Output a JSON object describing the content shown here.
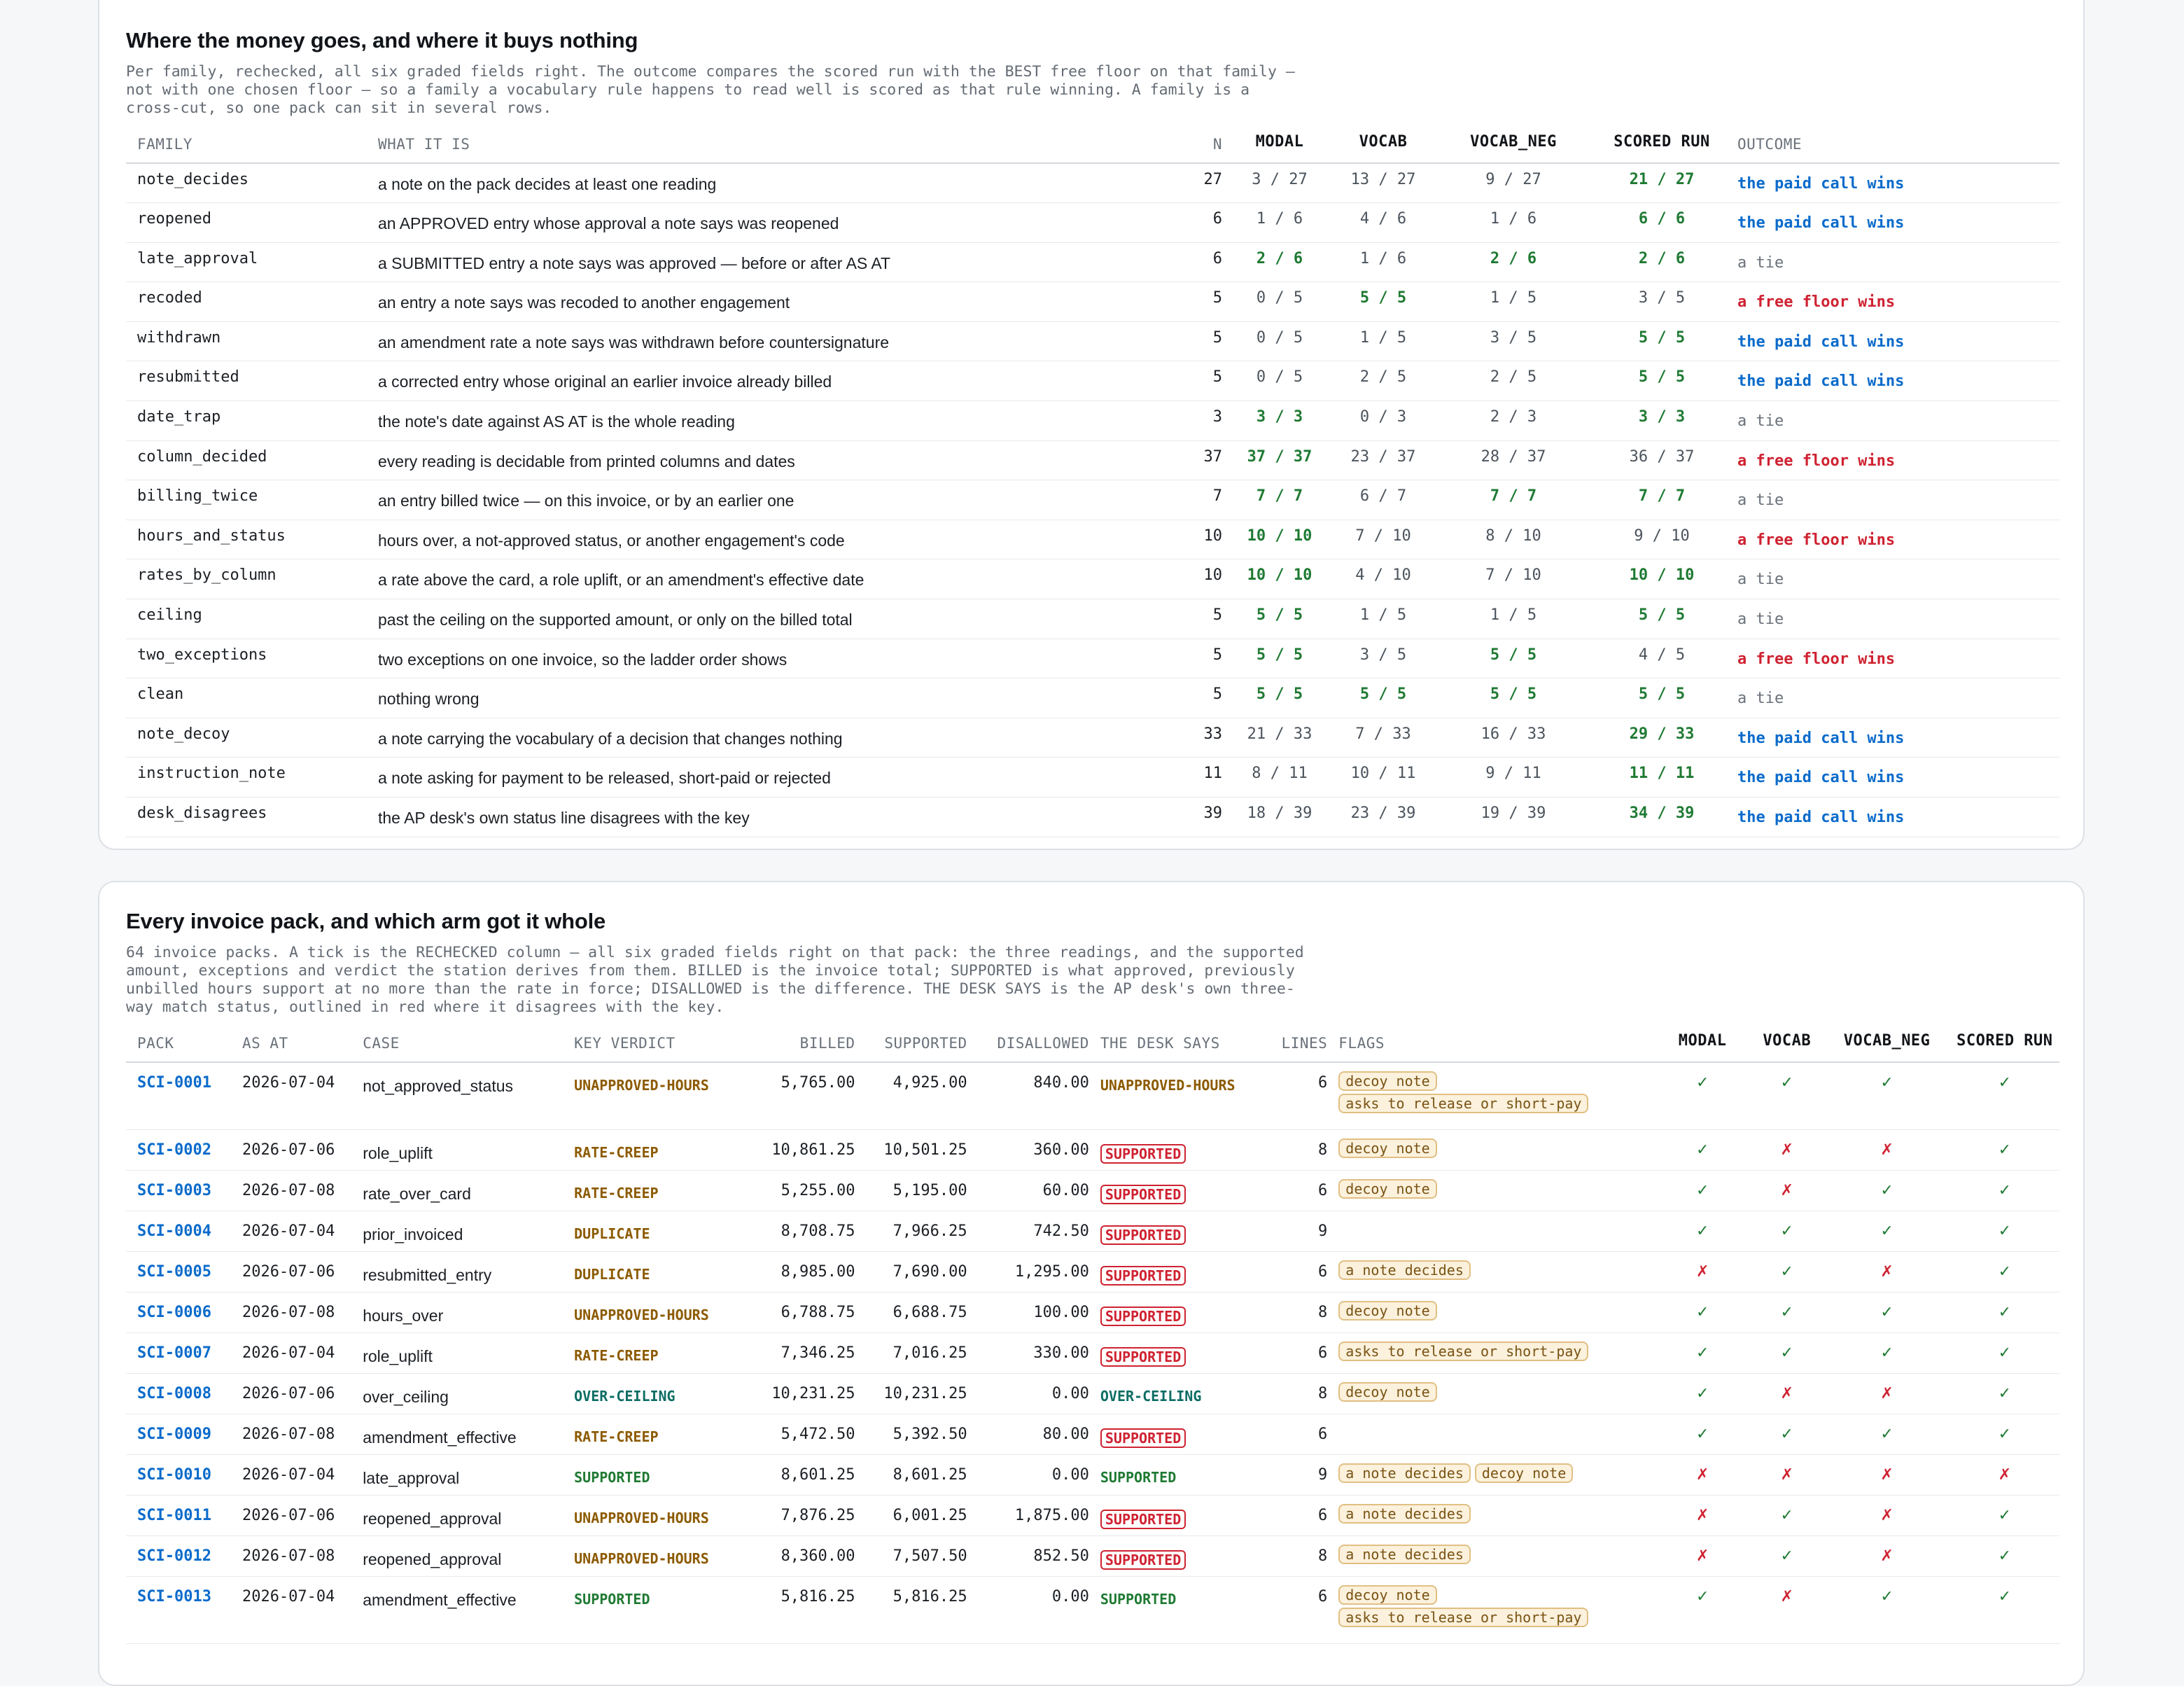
{
  "families": {
    "title": "Where the money goes, and where it buys nothing",
    "description": "Per family, rechecked, all six graded fields right. The outcome compares the scored run with the BEST free floor on that family —\nnot with one chosen floor — so a family a vocabulary rule happens to read well is scored as that rule winning. A family is a\ncross-cut, so one pack can sit in several rows.",
    "headers": {
      "family": "FAMILY",
      "what": "WHAT IT IS",
      "n": "N",
      "modal": "MODAL",
      "vocab": "VOCAB",
      "vocab_neg": "VOCAB_NEG",
      "scored": "SCORED RUN",
      "outcome": "OUTCOME"
    },
    "rows": [
      {
        "family": "note_decides",
        "what": "a note on the pack decides at least one reading",
        "n": "27",
        "modal": "3 / 27",
        "modal_hi": false,
        "vocab": "13 / 27",
        "vocab_hi": false,
        "vocab_neg": "9 / 27",
        "vocab_neg_hi": false,
        "scored": "21 / 27",
        "scored_hi": true,
        "outcome": "the paid call wins",
        "outcome_kind": "paid"
      },
      {
        "family": "reopened",
        "what": "an APPROVED entry whose approval a note says was reopened",
        "n": "6",
        "modal": "1 / 6",
        "modal_hi": false,
        "vocab": "4 / 6",
        "vocab_hi": false,
        "vocab_neg": "1 / 6",
        "vocab_neg_hi": false,
        "scored": "6 / 6",
        "scored_hi": true,
        "outcome": "the paid call wins",
        "outcome_kind": "paid"
      },
      {
        "family": "late_approval",
        "what": "a SUBMITTED entry a note says was approved — before or after AS AT",
        "n": "6",
        "modal": "2 / 6",
        "modal_hi": true,
        "vocab": "1 / 6",
        "vocab_hi": false,
        "vocab_neg": "2 / 6",
        "vocab_neg_hi": true,
        "scored": "2 / 6",
        "scored_hi": true,
        "outcome": "a tie",
        "outcome_kind": "tie"
      },
      {
        "family": "recoded",
        "what": "an entry a note says was recoded to another engagement",
        "n": "5",
        "modal": "0 / 5",
        "modal_hi": false,
        "vocab": "5 / 5",
        "vocab_hi": true,
        "vocab_neg": "1 / 5",
        "vocab_neg_hi": false,
        "scored": "3 / 5",
        "scored_hi": false,
        "outcome": "a free floor wins",
        "outcome_kind": "free"
      },
      {
        "family": "withdrawn",
        "what": "an amendment rate a note says was withdrawn before countersignature",
        "n": "5",
        "modal": "0 / 5",
        "modal_hi": false,
        "vocab": "1 / 5",
        "vocab_hi": false,
        "vocab_neg": "3 / 5",
        "vocab_neg_hi": false,
        "scored": "5 / 5",
        "scored_hi": true,
        "outcome": "the paid call wins",
        "outcome_kind": "paid"
      },
      {
        "family": "resubmitted",
        "what": "a corrected entry whose original an earlier invoice already billed",
        "n": "5",
        "modal": "0 / 5",
        "modal_hi": false,
        "vocab": "2 / 5",
        "vocab_hi": false,
        "vocab_neg": "2 / 5",
        "vocab_neg_hi": false,
        "scored": "5 / 5",
        "scored_hi": true,
        "outcome": "the paid call wins",
        "outcome_kind": "paid"
      },
      {
        "family": "date_trap",
        "what": "the note's date against AS AT is the whole reading",
        "n": "3",
        "modal": "3 / 3",
        "modal_hi": true,
        "vocab": "0 / 3",
        "vocab_hi": false,
        "vocab_neg": "2 / 3",
        "vocab_neg_hi": false,
        "scored": "3 / 3",
        "scored_hi": true,
        "outcome": "a tie",
        "outcome_kind": "tie"
      },
      {
        "family": "column_decided",
        "what": "every reading is decidable from printed columns and dates",
        "n": "37",
        "modal": "37 / 37",
        "modal_hi": true,
        "vocab": "23 / 37",
        "vocab_hi": false,
        "vocab_neg": "28 / 37",
        "vocab_neg_hi": false,
        "scored": "36 / 37",
        "scored_hi": false,
        "outcome": "a free floor wins",
        "outcome_kind": "free"
      },
      {
        "family": "billing_twice",
        "what": "an entry billed twice — on this invoice, or by an earlier one",
        "n": "7",
        "modal": "7 / 7",
        "modal_hi": true,
        "vocab": "6 / 7",
        "vocab_hi": false,
        "vocab_neg": "7 / 7",
        "vocab_neg_hi": true,
        "scored": "7 / 7",
        "scored_hi": true,
        "outcome": "a tie",
        "outcome_kind": "tie"
      },
      {
        "family": "hours_and_status",
        "what": "hours over, a not-approved status, or another engagement's code",
        "n": "10",
        "modal": "10 / 10",
        "modal_hi": true,
        "vocab": "7 / 10",
        "vocab_hi": false,
        "vocab_neg": "8 / 10",
        "vocab_neg_hi": false,
        "scored": "9 / 10",
        "scored_hi": false,
        "outcome": "a free floor wins",
        "outcome_kind": "free"
      },
      {
        "family": "rates_by_column",
        "what": "a rate above the card, a role uplift, or an amendment's effective date",
        "n": "10",
        "modal": "10 / 10",
        "modal_hi": true,
        "vocab": "4 / 10",
        "vocab_hi": false,
        "vocab_neg": "7 / 10",
        "vocab_neg_hi": false,
        "scored": "10 / 10",
        "scored_hi": true,
        "outcome": "a tie",
        "outcome_kind": "tie"
      },
      {
        "family": "ceiling",
        "what": "past the ceiling on the supported amount, or only on the billed total",
        "n": "5",
        "modal": "5 / 5",
        "modal_hi": true,
        "vocab": "1 / 5",
        "vocab_hi": false,
        "vocab_neg": "1 / 5",
        "vocab_neg_hi": false,
        "scored": "5 / 5",
        "scored_hi": true,
        "outcome": "a tie",
        "outcome_kind": "tie"
      },
      {
        "family": "two_exceptions",
        "what": "two exceptions on one invoice, so the ladder order shows",
        "n": "5",
        "modal": "5 / 5",
        "modal_hi": true,
        "vocab": "3 / 5",
        "vocab_hi": false,
        "vocab_neg": "5 / 5",
        "vocab_neg_hi": true,
        "scored": "4 / 5",
        "scored_hi": false,
        "outcome": "a free floor wins",
        "outcome_kind": "free"
      },
      {
        "family": "clean",
        "what": "nothing wrong",
        "n": "5",
        "modal": "5 / 5",
        "modal_hi": true,
        "vocab": "5 / 5",
        "vocab_hi": true,
        "vocab_neg": "5 / 5",
        "vocab_neg_hi": true,
        "scored": "5 / 5",
        "scored_hi": true,
        "outcome": "a tie",
        "outcome_kind": "tie"
      },
      {
        "family": "note_decoy",
        "what": "a note carrying the vocabulary of a decision that changes nothing",
        "n": "33",
        "modal": "21 / 33",
        "modal_hi": false,
        "vocab": "7 / 33",
        "vocab_hi": false,
        "vocab_neg": "16 / 33",
        "vocab_neg_hi": false,
        "scored": "29 / 33",
        "scored_hi": true,
        "outcome": "the paid call wins",
        "outcome_kind": "paid"
      },
      {
        "family": "instruction_note",
        "what": "a note asking for payment to be released, short-paid or rejected",
        "n": "11",
        "modal": "8 / 11",
        "modal_hi": false,
        "vocab": "10 / 11",
        "vocab_hi": false,
        "vocab_neg": "9 / 11",
        "vocab_neg_hi": false,
        "scored": "11 / 11",
        "scored_hi": true,
        "outcome": "the paid call wins",
        "outcome_kind": "paid"
      },
      {
        "family": "desk_disagrees",
        "what": "the AP desk's own status line disagrees with the key",
        "n": "39",
        "modal": "18 / 39",
        "modal_hi": false,
        "vocab": "23 / 39",
        "vocab_hi": false,
        "vocab_neg": "19 / 39",
        "vocab_neg_hi": false,
        "scored": "34 / 39",
        "scored_hi": true,
        "outcome": "the paid call wins",
        "outcome_kind": "paid"
      }
    ]
  },
  "packs": {
    "title": "Every invoice pack, and which arm got it whole",
    "description": "64 invoice packs. A tick is the RECHECKED column — all six graded fields right on that pack: the three readings, and the supported\namount, exceptions and verdict the station derives from them. BILLED is the invoice total; SUPPORTED is what approved, previously\nunbilled hours support at no more than the rate in force; DISALLOWED is the difference. THE DESK SAYS is the AP desk's own three-\nway match status, outlined in red where it disagrees with the key.",
    "headers": {
      "pack": "PACK",
      "asat": "AS AT",
      "case": "CASE",
      "verdict": "KEY VERDICT",
      "billed": "BILLED",
      "supported": "SUPPORTED",
      "disallowed": "DISALLOWED",
      "desk": "THE DESK SAYS",
      "lines": "LINES",
      "flags": "FLAGS",
      "modal": "MODAL",
      "vocab": "VOCAB",
      "vocab_neg": "VOCAB_NEG",
      "scored": "SCORED RUN"
    },
    "marks": {
      "yes": "✓",
      "no": "✗"
    },
    "rows": [
      {
        "pack": "SCI-0001",
        "asat": "2026-07-04",
        "case": "not_approved_status",
        "verdict": "UNAPPROVED-HOURS",
        "billed": "5,765.00",
        "supported": "4,925.00",
        "disallowed": "840.00",
        "desk": "UNAPPROVED-HOURS",
        "desk_disagrees": false,
        "lines": "6",
        "flags": [
          "decoy note",
          "asks to release or short-pay"
        ],
        "modal": true,
        "vocab": true,
        "vocab_neg": true,
        "scored": true
      },
      {
        "pack": "SCI-0002",
        "asat": "2026-07-06",
        "case": "role_uplift",
        "verdict": "RATE-CREEP",
        "billed": "10,861.25",
        "supported": "10,501.25",
        "disallowed": "360.00",
        "desk": "SUPPORTED",
        "desk_disagrees": true,
        "lines": "8",
        "flags": [
          "decoy note"
        ],
        "modal": true,
        "vocab": false,
        "vocab_neg": false,
        "scored": true
      },
      {
        "pack": "SCI-0003",
        "asat": "2026-07-08",
        "case": "rate_over_card",
        "verdict": "RATE-CREEP",
        "billed": "5,255.00",
        "supported": "5,195.00",
        "disallowed": "60.00",
        "desk": "SUPPORTED",
        "desk_disagrees": true,
        "lines": "6",
        "flags": [
          "decoy note"
        ],
        "modal": true,
        "vocab": false,
        "vocab_neg": true,
        "scored": true
      },
      {
        "pack": "SCI-0004",
        "asat": "2026-07-04",
        "case": "prior_invoiced",
        "verdict": "DUPLICATE",
        "billed": "8,708.75",
        "supported": "7,966.25",
        "disallowed": "742.50",
        "desk": "SUPPORTED",
        "desk_disagrees": true,
        "lines": "9",
        "flags": [],
        "modal": true,
        "vocab": true,
        "vocab_neg": true,
        "scored": true
      },
      {
        "pack": "SCI-0005",
        "asat": "2026-07-06",
        "case": "resubmitted_entry",
        "verdict": "DUPLICATE",
        "billed": "8,985.00",
        "supported": "7,690.00",
        "disallowed": "1,295.00",
        "desk": "SUPPORTED",
        "desk_disagrees": true,
        "lines": "6",
        "flags": [
          "a note decides"
        ],
        "modal": false,
        "vocab": true,
        "vocab_neg": false,
        "scored": true
      },
      {
        "pack": "SCI-0006",
        "asat": "2026-07-08",
        "case": "hours_over",
        "verdict": "UNAPPROVED-HOURS",
        "billed": "6,788.75",
        "supported": "6,688.75",
        "disallowed": "100.00",
        "desk": "SUPPORTED",
        "desk_disagrees": true,
        "lines": "8",
        "flags": [
          "decoy note"
        ],
        "modal": true,
        "vocab": true,
        "vocab_neg": true,
        "scored": true
      },
      {
        "pack": "SCI-0007",
        "asat": "2026-07-04",
        "case": "role_uplift",
        "verdict": "RATE-CREEP",
        "billed": "7,346.25",
        "supported": "7,016.25",
        "disallowed": "330.00",
        "desk": "SUPPORTED",
        "desk_disagrees": true,
        "lines": "6",
        "flags": [
          "asks to release or short-pay"
        ],
        "modal": true,
        "vocab": true,
        "vocab_neg": true,
        "scored": true
      },
      {
        "pack": "SCI-0008",
        "asat": "2026-07-06",
        "case": "over_ceiling",
        "verdict": "OVER-CEILING",
        "billed": "10,231.25",
        "supported": "10,231.25",
        "disallowed": "0.00",
        "desk": "OVER-CEILING",
        "desk_disagrees": false,
        "lines": "8",
        "flags": [
          "decoy note"
        ],
        "modal": true,
        "vocab": false,
        "vocab_neg": false,
        "scored": true
      },
      {
        "pack": "SCI-0009",
        "asat": "2026-07-08",
        "case": "amendment_effective",
        "verdict": "RATE-CREEP",
        "billed": "5,472.50",
        "supported": "5,392.50",
        "disallowed": "80.00",
        "desk": "SUPPORTED",
        "desk_disagrees": true,
        "lines": "6",
        "flags": [],
        "modal": true,
        "vocab": true,
        "vocab_neg": true,
        "scored": true
      },
      {
        "pack": "SCI-0010",
        "asat": "2026-07-04",
        "case": "late_approval",
        "verdict": "SUPPORTED",
        "billed": "8,601.25",
        "supported": "8,601.25",
        "disallowed": "0.00",
        "desk": "SUPPORTED",
        "desk_disagrees": false,
        "lines": "9",
        "flags": [
          "a note decides",
          "decoy note"
        ],
        "modal": false,
        "vocab": false,
        "vocab_neg": false,
        "scored": false
      },
      {
        "pack": "SCI-0011",
        "asat": "2026-07-06",
        "case": "reopened_approval",
        "verdict": "UNAPPROVED-HOURS",
        "billed": "7,876.25",
        "supported": "6,001.25",
        "disallowed": "1,875.00",
        "desk": "SUPPORTED",
        "desk_disagrees": true,
        "lines": "6",
        "flags": [
          "a note decides"
        ],
        "modal": false,
        "vocab": true,
        "vocab_neg": false,
        "scored": true
      },
      {
        "pack": "SCI-0012",
        "asat": "2026-07-08",
        "case": "reopened_approval",
        "verdict": "UNAPPROVED-HOURS",
        "billed": "8,360.00",
        "supported": "7,507.50",
        "disallowed": "852.50",
        "desk": "SUPPORTED",
        "desk_disagrees": true,
        "lines": "8",
        "flags": [
          "a note decides"
        ],
        "modal": false,
        "vocab": true,
        "vocab_neg": false,
        "scored": true
      },
      {
        "pack": "SCI-0013",
        "asat": "2026-07-04",
        "case": "amendment_effective",
        "verdict": "SUPPORTED",
        "billed": "5,816.25",
        "supported": "5,816.25",
        "disallowed": "0.00",
        "desk": "SUPPORTED",
        "desk_disagrees": false,
        "lines": "6",
        "flags": [
          "decoy note",
          "asks to release or short-pay"
        ],
        "modal": true,
        "vocab": false,
        "vocab_neg": true,
        "scored": true
      }
    ]
  },
  "colors": {
    "accent_blue": "#0b6bcb",
    "win_green": "#1f7a33",
    "lose_red": "#cf2231",
    "amber": "#8c5a00",
    "teal": "#0c6d64"
  }
}
